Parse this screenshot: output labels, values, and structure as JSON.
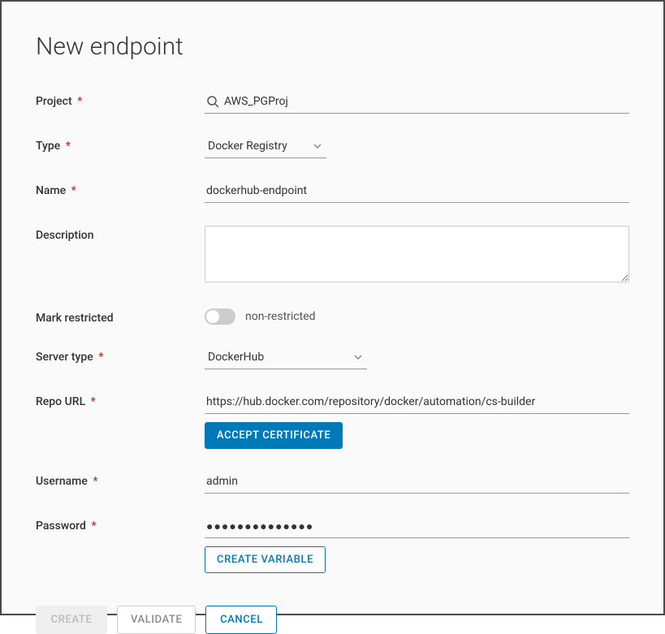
{
  "title": "New endpoint",
  "labels": {
    "project": "Project",
    "type": "Type",
    "name": "Name",
    "description": "Description",
    "markRestricted": "Mark restricted",
    "serverType": "Server type",
    "repoUrl": "Repo URL",
    "username": "Username",
    "password": "Password"
  },
  "fields": {
    "project": "AWS_PGProj",
    "type": "Docker Registry",
    "name": "dockerhub-endpoint",
    "description": "",
    "restrictedToggleText": "non-restricted",
    "serverType": "DockerHub",
    "repoUrl": "https://hub.docker.com/repository/docker/automation/cs-builder",
    "username": "admin",
    "password": "●●●●●●●●●●●●●●"
  },
  "buttons": {
    "acceptCertificate": "ACCEPT CERTIFICATE",
    "createVariable": "CREATE VARIABLE",
    "create": "CREATE",
    "validate": "VALIDATE",
    "cancel": "CANCEL"
  }
}
